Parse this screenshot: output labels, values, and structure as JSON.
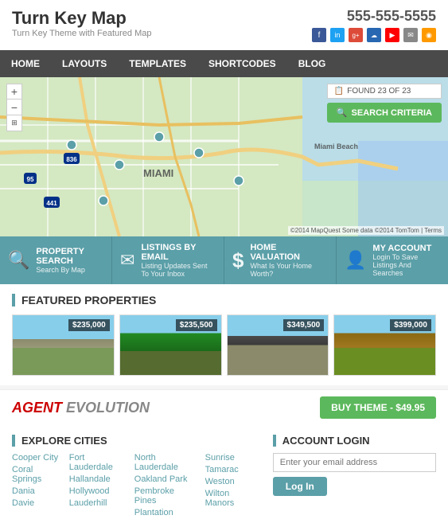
{
  "header": {
    "logo": "Turn Key Map",
    "tagline": "Turn Key Theme with Featured Map",
    "phone": "555-555-5555"
  },
  "social": [
    "f",
    "in",
    "g+",
    "☁",
    "▶",
    "✉",
    "◉"
  ],
  "nav": {
    "items": [
      "HOME",
      "LAYOUTS",
      "TEMPLATES",
      "SHORTCODES",
      "BLOG"
    ]
  },
  "map": {
    "found_label": "FOUND 23 OF 23",
    "search_btn": "SEARCH CRITERIA",
    "zoom_in": "+",
    "zoom_out": "−",
    "attribution": "©2014 MapQuest  Some data ©2014 TomTom | Terms"
  },
  "action_bar": [
    {
      "icon": "🔍",
      "title": "PROPERTY SEARCH",
      "subtitle": "Search By Map"
    },
    {
      "icon": "✉",
      "title": "LISTINGS BY EMAIL",
      "subtitle": "Listing Updates Sent To Your Inbox"
    },
    {
      "icon": "$",
      "title": "HOME VALUATION",
      "subtitle": "What Is Your Home Worth?"
    },
    {
      "icon": "👤",
      "title": "MY ACCOUNT",
      "subtitle": "Login To Save Listings And Searches"
    }
  ],
  "featured": {
    "title": "FEATURED PROPERTIES",
    "properties": [
      {
        "price": "$235,000"
      },
      {
        "price": "$235,500"
      },
      {
        "price": "$349,500"
      },
      {
        "price": "$399,000"
      }
    ]
  },
  "brand": {
    "logo_prefix": "AGENT",
    "logo_suffix": "EVOLUTION",
    "buy_btn": "BUY THEME - $49.95"
  },
  "explore": {
    "title": "EXPLORE CITIES",
    "columns": [
      [
        "Cooper City",
        "Coral Springs",
        "Dania",
        "Davie"
      ],
      [
        "Fort Lauderdale",
        "Hallandale",
        "Hollywood",
        "Lauderhill"
      ],
      [
        "North Lauderdale",
        "Oakland Park",
        "Pembroke Pines",
        "Plantation"
      ],
      [
        "Sunrise",
        "Tamarac",
        "Weston",
        "Wilton Manors"
      ]
    ]
  },
  "account": {
    "title": "ACCOUNT LOGIN",
    "email_placeholder": "Enter your email address",
    "login_btn": "Log In"
  }
}
